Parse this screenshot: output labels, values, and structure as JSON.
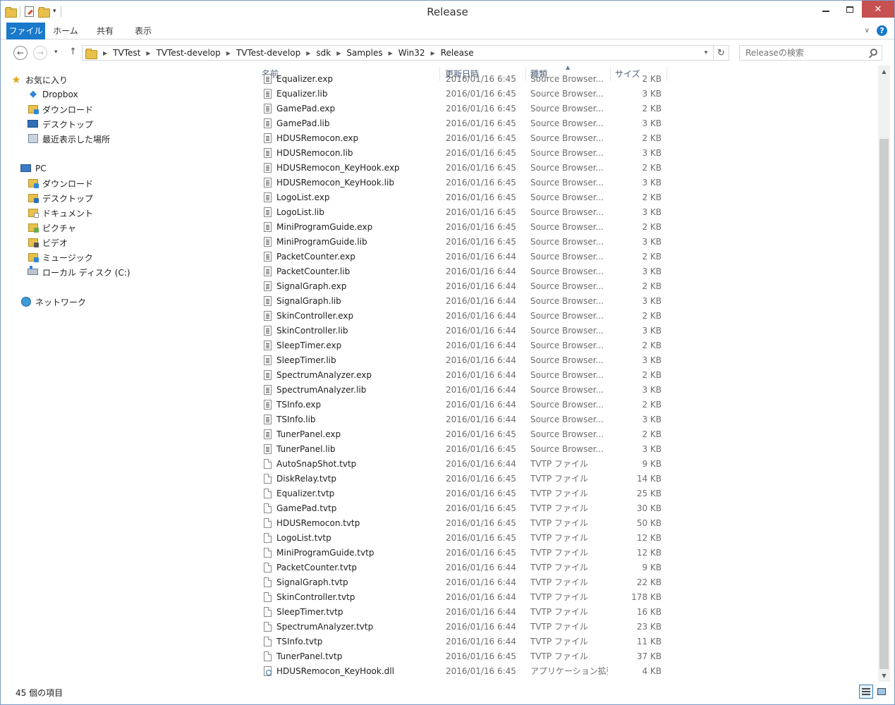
{
  "window": {
    "title": "Release"
  },
  "ribbon": {
    "tabs": [
      "ファイル",
      "ホーム",
      "共有",
      "表示"
    ]
  },
  "address": {
    "crumbs": [
      "TVTest",
      "TVTest-develop",
      "TVTest-develop",
      "sdk",
      "Samples",
      "Win32",
      "Release"
    ]
  },
  "search": {
    "placeholder": "Releaseの検索"
  },
  "sidebar": {
    "favorites": {
      "label": "お気に入り",
      "items": [
        "Dropbox",
        "ダウンロード",
        "デスクトップ",
        "最近表示した場所"
      ]
    },
    "pc": {
      "label": "PC",
      "items": [
        "ダウンロード",
        "デスクトップ",
        "ドキュメント",
        "ピクチャ",
        "ビデオ",
        "ミュージック",
        "ローカル ディスク (C:)"
      ]
    },
    "network": {
      "label": "ネットワーク"
    }
  },
  "columns": {
    "name": "名前",
    "date": "更新日時",
    "type": "種類",
    "size": "サイズ"
  },
  "files": [
    {
      "name": "Equalizer.exp",
      "date": "2016/01/16 6:45",
      "type": "Source Browser...",
      "size": "2 KB",
      "icon": "src"
    },
    {
      "name": "Equalizer.lib",
      "date": "2016/01/16 6:45",
      "type": "Source Browser...",
      "size": "3 KB",
      "icon": "src"
    },
    {
      "name": "GamePad.exp",
      "date": "2016/01/16 6:45",
      "type": "Source Browser...",
      "size": "2 KB",
      "icon": "src"
    },
    {
      "name": "GamePad.lib",
      "date": "2016/01/16 6:45",
      "type": "Source Browser...",
      "size": "3 KB",
      "icon": "src"
    },
    {
      "name": "HDUSRemocon.exp",
      "date": "2016/01/16 6:45",
      "type": "Source Browser...",
      "size": "2 KB",
      "icon": "src"
    },
    {
      "name": "HDUSRemocon.lib",
      "date": "2016/01/16 6:45",
      "type": "Source Browser...",
      "size": "3 KB",
      "icon": "src"
    },
    {
      "name": "HDUSRemocon_KeyHook.exp",
      "date": "2016/01/16 6:45",
      "type": "Source Browser...",
      "size": "2 KB",
      "icon": "src"
    },
    {
      "name": "HDUSRemocon_KeyHook.lib",
      "date": "2016/01/16 6:45",
      "type": "Source Browser...",
      "size": "3 KB",
      "icon": "src"
    },
    {
      "name": "LogoList.exp",
      "date": "2016/01/16 6:45",
      "type": "Source Browser...",
      "size": "2 KB",
      "icon": "src"
    },
    {
      "name": "LogoList.lib",
      "date": "2016/01/16 6:45",
      "type": "Source Browser...",
      "size": "3 KB",
      "icon": "src"
    },
    {
      "name": "MiniProgramGuide.exp",
      "date": "2016/01/16 6:45",
      "type": "Source Browser...",
      "size": "2 KB",
      "icon": "src"
    },
    {
      "name": "MiniProgramGuide.lib",
      "date": "2016/01/16 6:45",
      "type": "Source Browser...",
      "size": "3 KB",
      "icon": "src"
    },
    {
      "name": "PacketCounter.exp",
      "date": "2016/01/16 6:44",
      "type": "Source Browser...",
      "size": "2 KB",
      "icon": "src"
    },
    {
      "name": "PacketCounter.lib",
      "date": "2016/01/16 6:44",
      "type": "Source Browser...",
      "size": "3 KB",
      "icon": "src"
    },
    {
      "name": "SignalGraph.exp",
      "date": "2016/01/16 6:44",
      "type": "Source Browser...",
      "size": "2 KB",
      "icon": "src"
    },
    {
      "name": "SignalGraph.lib",
      "date": "2016/01/16 6:44",
      "type": "Source Browser...",
      "size": "3 KB",
      "icon": "src"
    },
    {
      "name": "SkinController.exp",
      "date": "2016/01/16 6:44",
      "type": "Source Browser...",
      "size": "2 KB",
      "icon": "src"
    },
    {
      "name": "SkinController.lib",
      "date": "2016/01/16 6:44",
      "type": "Source Browser...",
      "size": "3 KB",
      "icon": "src"
    },
    {
      "name": "SleepTimer.exp",
      "date": "2016/01/16 6:44",
      "type": "Source Browser...",
      "size": "2 KB",
      "icon": "src"
    },
    {
      "name": "SleepTimer.lib",
      "date": "2016/01/16 6:44",
      "type": "Source Browser...",
      "size": "3 KB",
      "icon": "src"
    },
    {
      "name": "SpectrumAnalyzer.exp",
      "date": "2016/01/16 6:44",
      "type": "Source Browser...",
      "size": "2 KB",
      "icon": "src"
    },
    {
      "name": "SpectrumAnalyzer.lib",
      "date": "2016/01/16 6:44",
      "type": "Source Browser...",
      "size": "3 KB",
      "icon": "src"
    },
    {
      "name": "TSInfo.exp",
      "date": "2016/01/16 6:44",
      "type": "Source Browser...",
      "size": "2 KB",
      "icon": "src"
    },
    {
      "name": "TSInfo.lib",
      "date": "2016/01/16 6:44",
      "type": "Source Browser...",
      "size": "3 KB",
      "icon": "src"
    },
    {
      "name": "TunerPanel.exp",
      "date": "2016/01/16 6:45",
      "type": "Source Browser...",
      "size": "2 KB",
      "icon": "src"
    },
    {
      "name": "TunerPanel.lib",
      "date": "2016/01/16 6:45",
      "type": "Source Browser...",
      "size": "3 KB",
      "icon": "src"
    },
    {
      "name": "AutoSnapShot.tvtp",
      "date": "2016/01/16 6:44",
      "type": "TVTP ファイル",
      "size": "9 KB",
      "icon": "plain"
    },
    {
      "name": "DiskRelay.tvtp",
      "date": "2016/01/16 6:45",
      "type": "TVTP ファイル",
      "size": "14 KB",
      "icon": "plain"
    },
    {
      "name": "Equalizer.tvtp",
      "date": "2016/01/16 6:45",
      "type": "TVTP ファイル",
      "size": "25 KB",
      "icon": "plain"
    },
    {
      "name": "GamePad.tvtp",
      "date": "2016/01/16 6:45",
      "type": "TVTP ファイル",
      "size": "30 KB",
      "icon": "plain"
    },
    {
      "name": "HDUSRemocon.tvtp",
      "date": "2016/01/16 6:45",
      "type": "TVTP ファイル",
      "size": "50 KB",
      "icon": "plain"
    },
    {
      "name": "LogoList.tvtp",
      "date": "2016/01/16 6:45",
      "type": "TVTP ファイル",
      "size": "12 KB",
      "icon": "plain"
    },
    {
      "name": "MiniProgramGuide.tvtp",
      "date": "2016/01/16 6:45",
      "type": "TVTP ファイル",
      "size": "12 KB",
      "icon": "plain"
    },
    {
      "name": "PacketCounter.tvtp",
      "date": "2016/01/16 6:44",
      "type": "TVTP ファイル",
      "size": "9 KB",
      "icon": "plain"
    },
    {
      "name": "SignalGraph.tvtp",
      "date": "2016/01/16 6:44",
      "type": "TVTP ファイル",
      "size": "22 KB",
      "icon": "plain"
    },
    {
      "name": "SkinController.tvtp",
      "date": "2016/01/16 6:44",
      "type": "TVTP ファイル",
      "size": "178 KB",
      "icon": "plain"
    },
    {
      "name": "SleepTimer.tvtp",
      "date": "2016/01/16 6:44",
      "type": "TVTP ファイル",
      "size": "16 KB",
      "icon": "plain"
    },
    {
      "name": "SpectrumAnalyzer.tvtp",
      "date": "2016/01/16 6:44",
      "type": "TVTP ファイル",
      "size": "23 KB",
      "icon": "plain"
    },
    {
      "name": "TSInfo.tvtp",
      "date": "2016/01/16 6:44",
      "type": "TVTP ファイル",
      "size": "11 KB",
      "icon": "plain"
    },
    {
      "name": "TunerPanel.tvtp",
      "date": "2016/01/16 6:45",
      "type": "TVTP ファイル",
      "size": "37 KB",
      "icon": "plain"
    },
    {
      "name": "HDUSRemocon_KeyHook.dll",
      "date": "2016/01/16 6:45",
      "type": "アプリケーション拡張",
      "size": "4 KB",
      "icon": "dll"
    }
  ],
  "status": {
    "count": "45 個の項目"
  },
  "colors": {
    "accent": "#1979ca",
    "close": "#c75050"
  }
}
